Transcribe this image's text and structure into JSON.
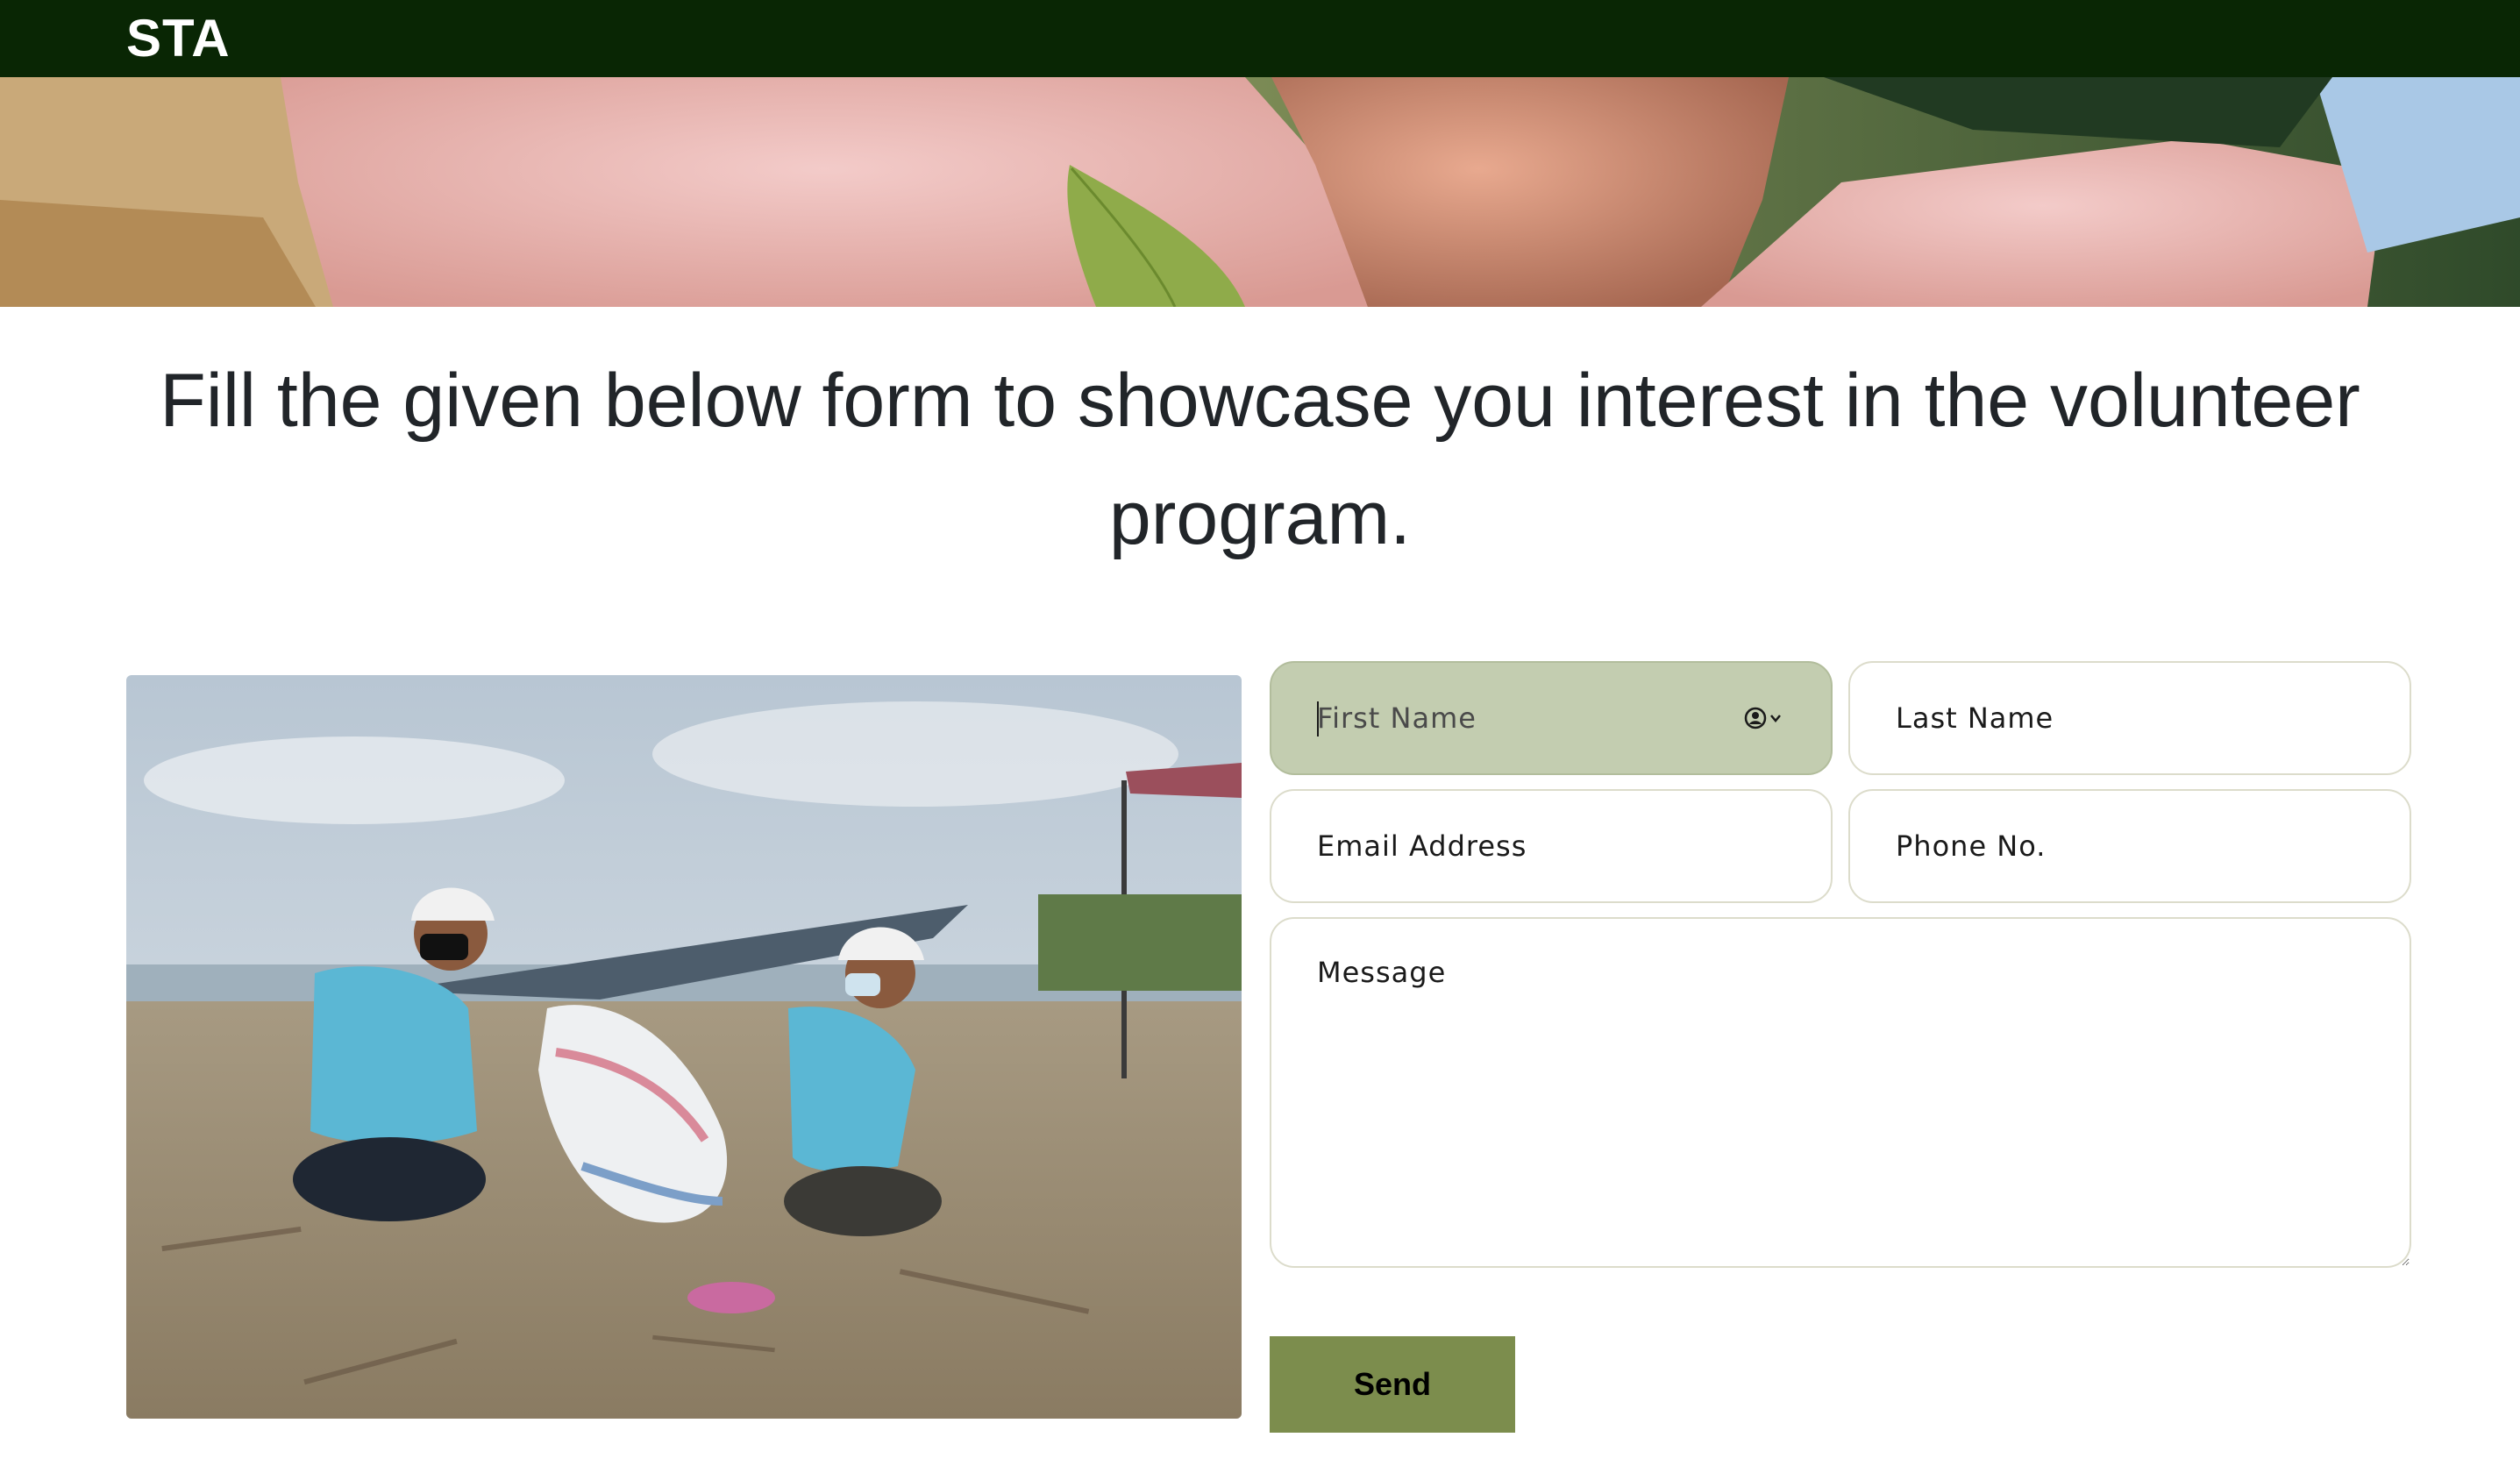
{
  "navbar": {
    "brand": "STA"
  },
  "main": {
    "headline": "Fill the given below form to showcase you interest in the volunteer program."
  },
  "form": {
    "first_name": {
      "placeholder": "First Name",
      "value": ""
    },
    "last_name": {
      "placeholder": "Last Name",
      "value": ""
    },
    "email": {
      "placeholder": "Email Address",
      "value": ""
    },
    "phone": {
      "placeholder": "Phone No.",
      "value": ""
    },
    "message": {
      "placeholder": "Message",
      "value": ""
    },
    "send_label": "Send",
    "focused_field": "first_name"
  },
  "icons": {
    "autofill": "contact-autofill-icon"
  },
  "colors": {
    "navbar_bg": "#092604",
    "focused_field_bg": "#c3cdb0",
    "send_button_bg": "#7c8d4d",
    "field_border": "#dcdccb",
    "headline_text": "#212529"
  }
}
